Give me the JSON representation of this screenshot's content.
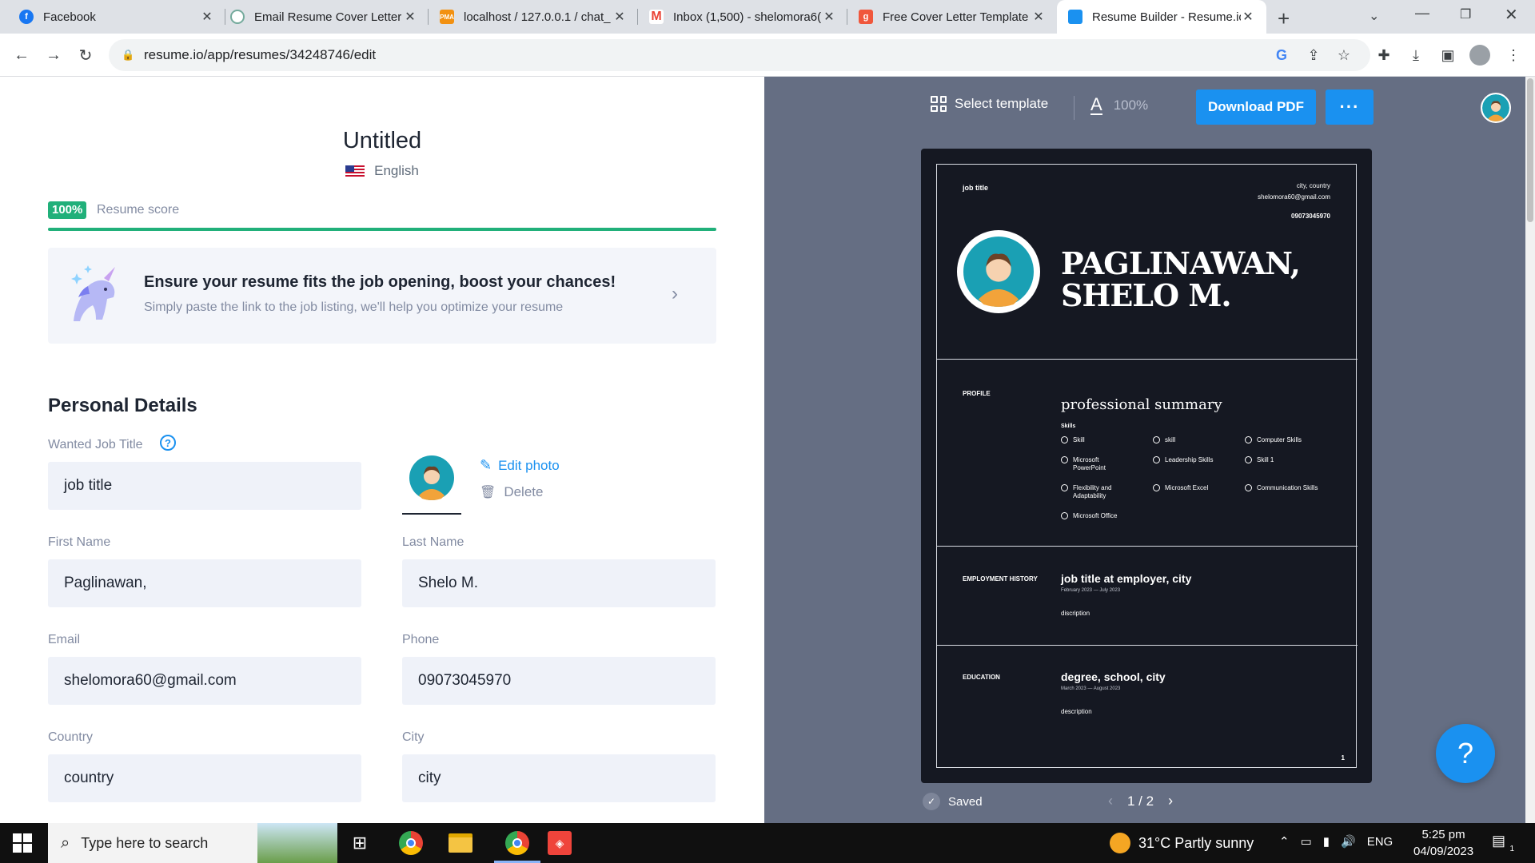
{
  "browser": {
    "tabs": [
      {
        "title": "Facebook",
        "favicon": "facebook-icon",
        "color": "#1877f2"
      },
      {
        "title": "Email Resume Cover Letter",
        "favicon": "chatgpt-icon",
        "color": "#74aa9c"
      },
      {
        "title": "localhost / 127.0.0.1 / chat_",
        "favicon": "phpmyadmin-icon",
        "color": "#f29111"
      },
      {
        "title": "Inbox (1,500) - shelomora6(",
        "favicon": "gmail-icon",
        "color": "#ea4335"
      },
      {
        "title": "Free Cover Letter Template",
        "favicon": "g-icon",
        "color": "#f0573c"
      },
      {
        "title": "Resume Builder - Resume.io",
        "favicon": "resumeio-icon",
        "color": "#1a91f0"
      }
    ],
    "url": "resume.io/app/resumes/34248746/edit"
  },
  "editor": {
    "title": "Untitled",
    "language": "English",
    "score_percent": "100%",
    "score_label": "Resume score",
    "promo_title": "Ensure your resume fits the job opening, boost your chances!",
    "promo_subtitle": "Simply paste the link to the job listing, we'll help you optimize your resume",
    "section_heading": "Personal Details",
    "fields": {
      "job_title": {
        "label": "Wanted Job Title",
        "value": "job title"
      },
      "first_name": {
        "label": "First Name",
        "value": "Paglinawan,"
      },
      "last_name": {
        "label": "Last Name",
        "value": "Shelo M."
      },
      "email": {
        "label": "Email",
        "value": "shelomora60@gmail.com"
      },
      "phone": {
        "label": "Phone",
        "value": "09073045970"
      },
      "country": {
        "label": "Country",
        "value": "country"
      },
      "city": {
        "label": "City",
        "value": "city"
      }
    },
    "edit_photo": "Edit photo",
    "delete_photo": "Delete"
  },
  "preview": {
    "select_template": "Select template",
    "zoom": "100%",
    "download": "Download PDF",
    "more": "···",
    "saved": "Saved",
    "page": "1 / 2",
    "help": "?",
    "resume": {
      "job_title": "job title",
      "location": "city, country",
      "email": "shelomora60@gmail.com",
      "phone": "09073045970",
      "name_line1": "PAGLINAWAN,",
      "name_line2": "SHELO M.",
      "profile_label": "PROFILE",
      "summary": "professional summary",
      "skills_label": "Skills",
      "skills": [
        "Skill",
        "skill",
        "Computer Skills",
        "Microsoft PowerPoint",
        "Leadership Skills",
        "Skill 1",
        "Flexibility and Adaptability",
        "Microsoft Excel",
        "Communication Skills",
        "Microsoft Office"
      ],
      "employment_label": "EMPLOYMENT HISTORY",
      "employment_title": "job title at employer, city",
      "employment_dates": "February 2023 — July 2023",
      "employment_desc": "discription",
      "education_label": "EDUCATION",
      "education_title": "degree, school, city",
      "education_dates": "March 2023 — August 2023",
      "education_desc": "description",
      "page_number": "1"
    }
  },
  "taskbar": {
    "search_placeholder": "Type here to search",
    "weather": "31°C  Partly sunny",
    "language": "ENG",
    "time": "5:25 pm",
    "date": "04/09/2023",
    "notif_count": "1"
  }
}
